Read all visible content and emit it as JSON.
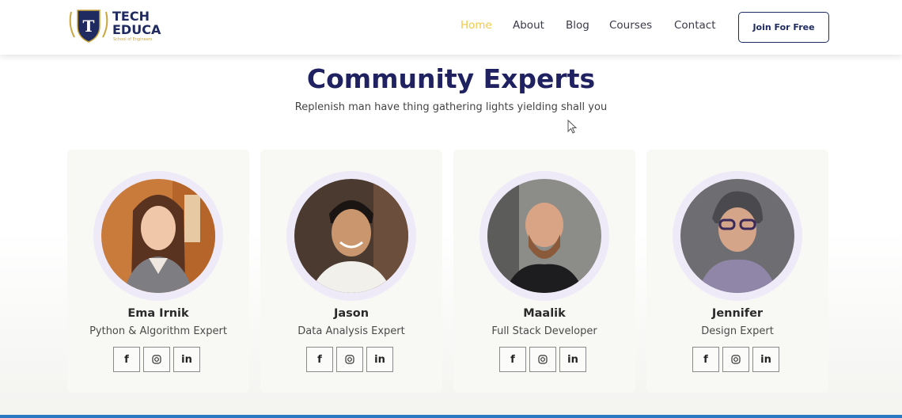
{
  "brand": {
    "line1": "TECH",
    "line2": "EDUCA",
    "tagline": "School of Engineers",
    "shield_letter": "T",
    "colors": {
      "navy": "#1f2a60",
      "gold": "#c9a53b"
    }
  },
  "nav": {
    "items": [
      {
        "label": "Home",
        "active": true
      },
      {
        "label": "About",
        "active": false
      },
      {
        "label": "Blog",
        "active": false
      },
      {
        "label": "Courses",
        "active": false
      },
      {
        "label": "Contact",
        "active": false
      }
    ],
    "cta_label": "Join For Free",
    "active_color": "#f0c94a"
  },
  "section": {
    "title": "Community Experts",
    "subtitle": "Replenish man have thing gathering lights yielding shall you"
  },
  "experts": [
    {
      "name": "Ema Irnik",
      "role": "Python & Algorithm Expert"
    },
    {
      "name": "Jason",
      "role": "Data Analysis Expert"
    },
    {
      "name": "Maalik",
      "role": "Full Stack Developer"
    },
    {
      "name": "Jennifer",
      "role": "Design Expert"
    }
  ],
  "social_icons": {
    "facebook": "f",
    "instagram": "instagram-icon",
    "linkedin": "in"
  }
}
